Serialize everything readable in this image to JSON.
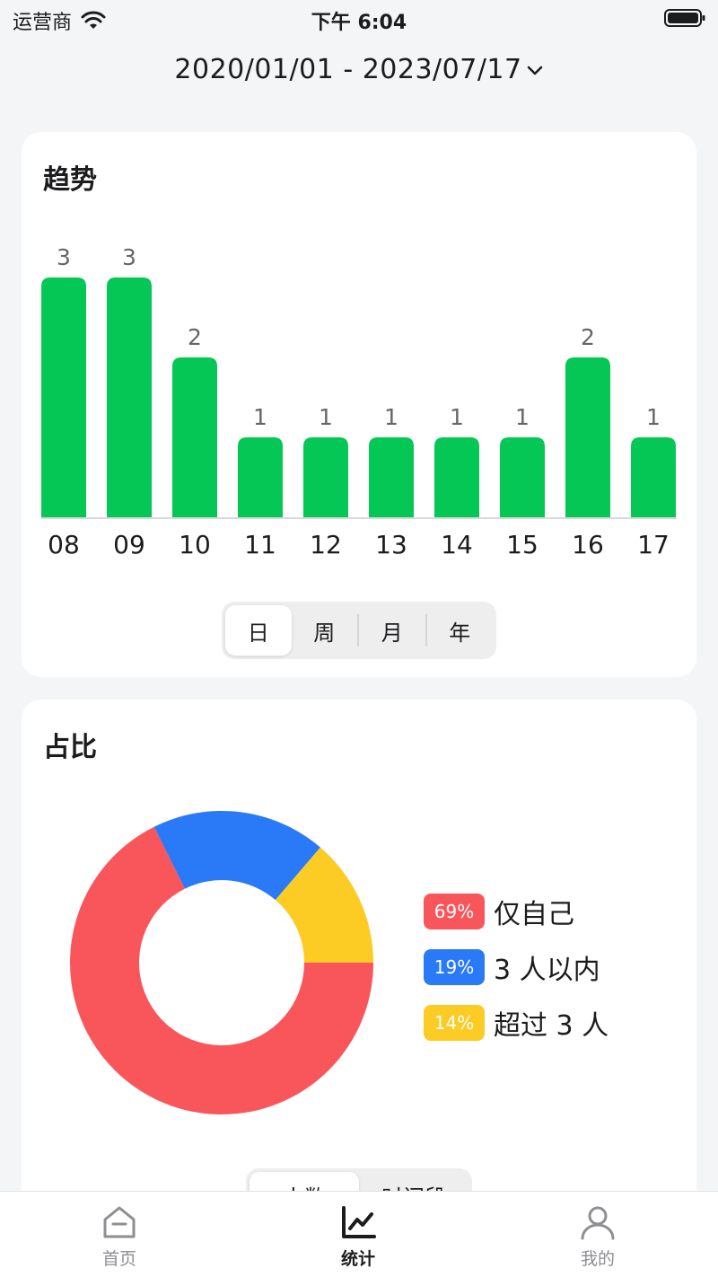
{
  "status_bar": {
    "carrier": "运营商",
    "time": "下午 6:04"
  },
  "date_range": "2020/01/01 - 2023/07/17",
  "trend": {
    "title": "趋势",
    "periods": [
      "日",
      "周",
      "月",
      "年"
    ],
    "active_period": "日"
  },
  "chart_data": [
    {
      "type": "bar",
      "title": "趋势",
      "categories": [
        "08",
        "09",
        "10",
        "11",
        "12",
        "13",
        "14",
        "15",
        "16",
        "17"
      ],
      "values": [
        3,
        3,
        2,
        1,
        1,
        1,
        1,
        1,
        2,
        1
      ],
      "ylim": [
        0,
        3
      ],
      "grid": false,
      "colors": [
        "#05c755"
      ]
    },
    {
      "type": "pie",
      "title": "占比",
      "categories": [
        "仅自己",
        "3 人以内",
        "超过 3 人"
      ],
      "values": [
        69,
        19,
        14
      ],
      "labels": [
        "69%",
        "19%",
        "14%"
      ],
      "colors": [
        "#f9565c",
        "#2a79f7",
        "#fccb24"
      ],
      "legend": "right"
    }
  ],
  "ratio": {
    "title": "占比",
    "legend": [
      {
        "pct": "69%",
        "label": "仅自己",
        "color": "#f9565c"
      },
      {
        "pct": "19%",
        "label": "3 人以内",
        "color": "#2a79f7"
      },
      {
        "pct": "14%",
        "label": "超过 3 人",
        "color": "#fccb24"
      }
    ],
    "toggle": [
      "人数",
      "时间段"
    ]
  },
  "tabbar": {
    "items": [
      {
        "label": "首页",
        "icon": "home-icon"
      },
      {
        "label": "统计",
        "icon": "chart-icon"
      },
      {
        "label": "我的",
        "icon": "person-icon"
      }
    ],
    "active": "统计"
  }
}
